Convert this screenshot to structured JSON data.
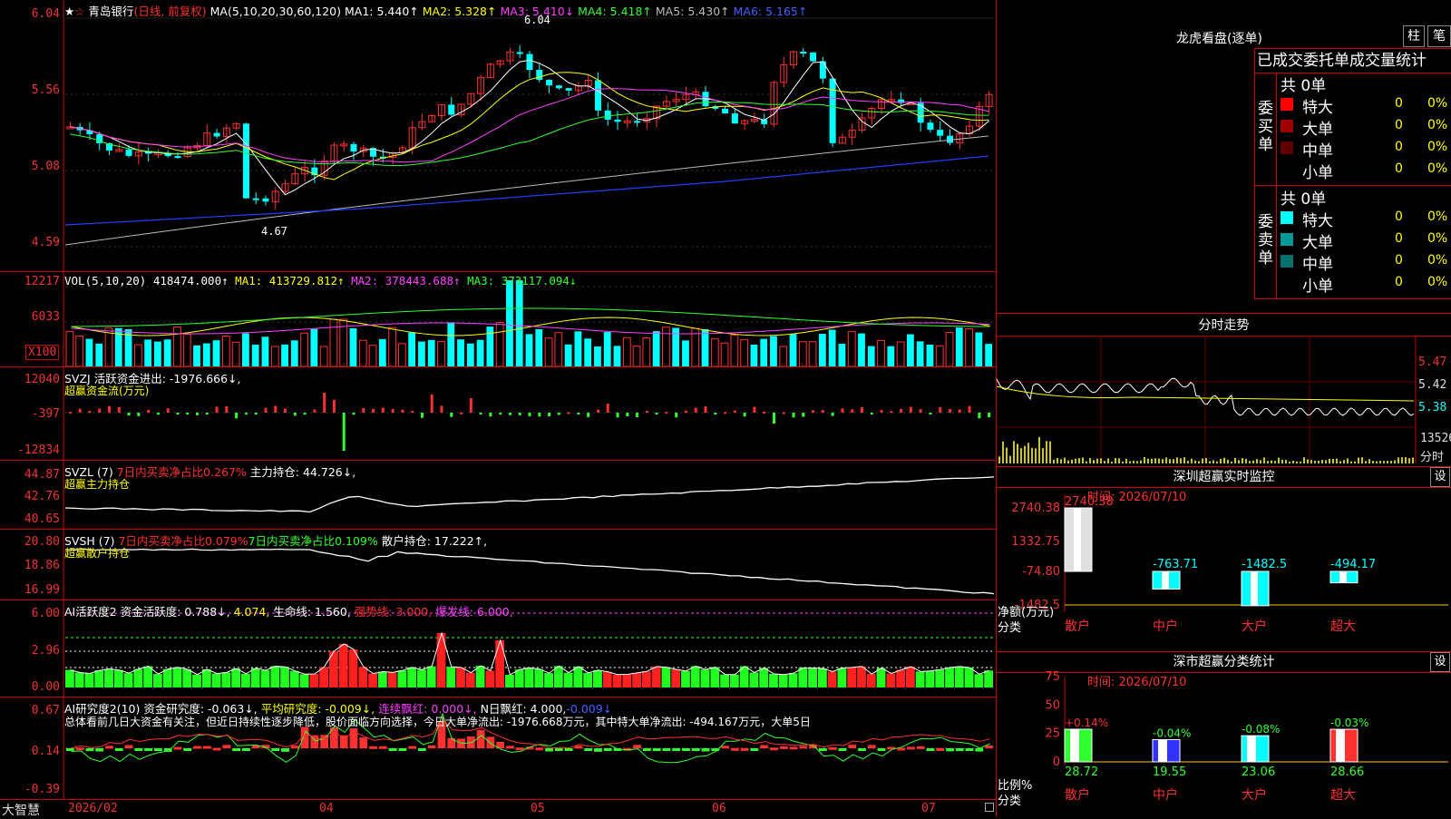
{
  "header": {
    "stock": "青岛银行",
    "mode": "(日线, 前复权)",
    "ma_def": "MA(5,10,20,30,60,120)",
    "ma1": "MA1: 5.440↑",
    "ma2": "MA2: 5.328↑",
    "ma3": "MA3: 5.410↓",
    "ma4": "MA4: 5.418↑",
    "ma5": "MA5: 5.430↑",
    "ma6": "MA6: 5.165↑"
  },
  "price_axis": [
    "6.04",
    "5.56",
    "5.08",
    "4.59"
  ],
  "price_notes": {
    "high": "6.04",
    "low": "4.67"
  },
  "vol": {
    "label": "VOL(5,10,20)",
    "value": "418474.000↑",
    "ma1": "MA1: 413729.812↑",
    "ma2": "MA2: 378443.688↑",
    "ma3": "MA3: 373117.094↓",
    "axis": [
      "12217",
      "6033"
    ],
    "unit": "X100"
  },
  "svzj": {
    "label": "SVZJ",
    "text": "活跃资金进出: -1976.666↓,",
    "sub": "超赢资金流(万元)",
    "axis": [
      "12040",
      "-397",
      "-12834"
    ]
  },
  "svzl": {
    "label": "SVZL (7)",
    "t1": "7日内买卖净占比0.267%",
    "t2": "主力持仓: 44.726↓,",
    "sub": "超赢主力持仓",
    "axis": [
      "44.87",
      "42.76",
      "40.65"
    ]
  },
  "svsh": {
    "label": "SVSH (7)",
    "t1": "7日内买卖净占比0.079%",
    "t2": "7日内买卖净占比0.109%",
    "t3": "散户持仓: 17.222↑,",
    "sub": "超赢散户持仓",
    "axis": [
      "20.80",
      "18.86",
      "16.99"
    ]
  },
  "ai1": {
    "label": "AI活跃度2",
    "t1": "资金活跃度: 0.788↓,",
    "t2": "4.074,",
    "t3": "生命线: 1.560,",
    "t4": "强势线: 3.000,",
    "t5": "爆发线: 6.000,",
    "axis": [
      "6.00",
      "2.96",
      "0.00"
    ]
  },
  "ai2": {
    "label": "AI研究度2(10)",
    "t1": "资金研究度: -0.063↓,",
    "t2": "平均研究度: -0.009↓,",
    "t3": "连续飘红: 0.000↓,",
    "t4": "N日飘红: 4.000,",
    "t5": "-0.009↓",
    "summary": "总体看前几日大资金有关注，但近日持续性逐步降低，股价面临方向选择，今日大单净流出: -1976.668万元，其中特大单净流出: -494.167万元，大单5日",
    "axis": [
      "0.67",
      "0.14",
      "-0.39"
    ]
  },
  "xaxis": {
    "brand": "大智慧",
    "labels": [
      "2026/02",
      "04",
      "05",
      "06",
      "07"
    ]
  },
  "dragon": {
    "title": "龙虎看盘(逐单)",
    "btn1": "柱",
    "btn2": "笔",
    "tab_title": "已成交委托单成交量统计",
    "buy_label": "委买单",
    "sell_label": "委卖单",
    "buy_total": "共 0单",
    "sell_total": "共 0单",
    "buy_rows": [
      {
        "name": "特大",
        "count": "0",
        "pct": "0%",
        "color": "#ff0000"
      },
      {
        "name": "大单",
        "count": "0",
        "pct": "0%",
        "color": "#a00000"
      },
      {
        "name": "中单",
        "count": "0",
        "pct": "0%",
        "color": "#600000"
      },
      {
        "name": "小单",
        "count": "0",
        "pct": "0%",
        "color": "#000000"
      }
    ],
    "sell_rows": [
      {
        "name": "特大",
        "count": "0",
        "pct": "0%",
        "color": "#00ffff"
      },
      {
        "name": "大单",
        "count": "0",
        "pct": "0%",
        "color": "#009a9a"
      },
      {
        "name": "中单",
        "count": "0",
        "pct": "0%",
        "color": "#007070"
      },
      {
        "name": "小单",
        "count": "0",
        "pct": "0%",
        "color": "#000000"
      }
    ]
  },
  "intraday": {
    "title": "分时走势",
    "axis": [
      "5.47",
      "5.42",
      "5.38"
    ],
    "vol_label": "13526",
    "footer": "分时"
  },
  "monitor": {
    "title": "深圳超赢实时监控",
    "btn": "设",
    "time": "时间: 2026/07/10",
    "axis": [
      "2740.38",
      "1332.75",
      "-74.80",
      "-1482.5"
    ],
    "top_value": "2740.38",
    "net_label": "净额(万元)",
    "cat_label": "分类",
    "bars": [
      {
        "name": "散户",
        "value": 2740.38,
        "label": "2740.38"
      },
      {
        "name": "中户",
        "value": -763.71,
        "label": "-763.71"
      },
      {
        "name": "大户",
        "value": -1482.5,
        "label": "-1482.5"
      },
      {
        "name": "超大",
        "value": -494.17,
        "label": "-494.17"
      }
    ]
  },
  "classify": {
    "title": "深市超赢分类统计",
    "btn": "设",
    "time": "时间: 2026/07/10",
    "axis": [
      "75",
      "50",
      "25",
      "0"
    ],
    "ratio_label": "比例%",
    "cat_label": "分类",
    "bars": [
      {
        "name": "散户",
        "pct": 28.72,
        "label": "28.72",
        "change": "+0.14%",
        "color": "#30ff30"
      },
      {
        "name": "中户",
        "pct": 19.55,
        "label": "19.55",
        "change": "-0.04%",
        "color": "#3030ff"
      },
      {
        "name": "大户",
        "pct": 23.06,
        "label": "23.06",
        "change": "-0.08%",
        "color": "#00ffff"
      },
      {
        "name": "超大",
        "pct": 28.66,
        "label": "28.66",
        "change": "-0.03%",
        "color": "#ff3030"
      }
    ]
  }
}
